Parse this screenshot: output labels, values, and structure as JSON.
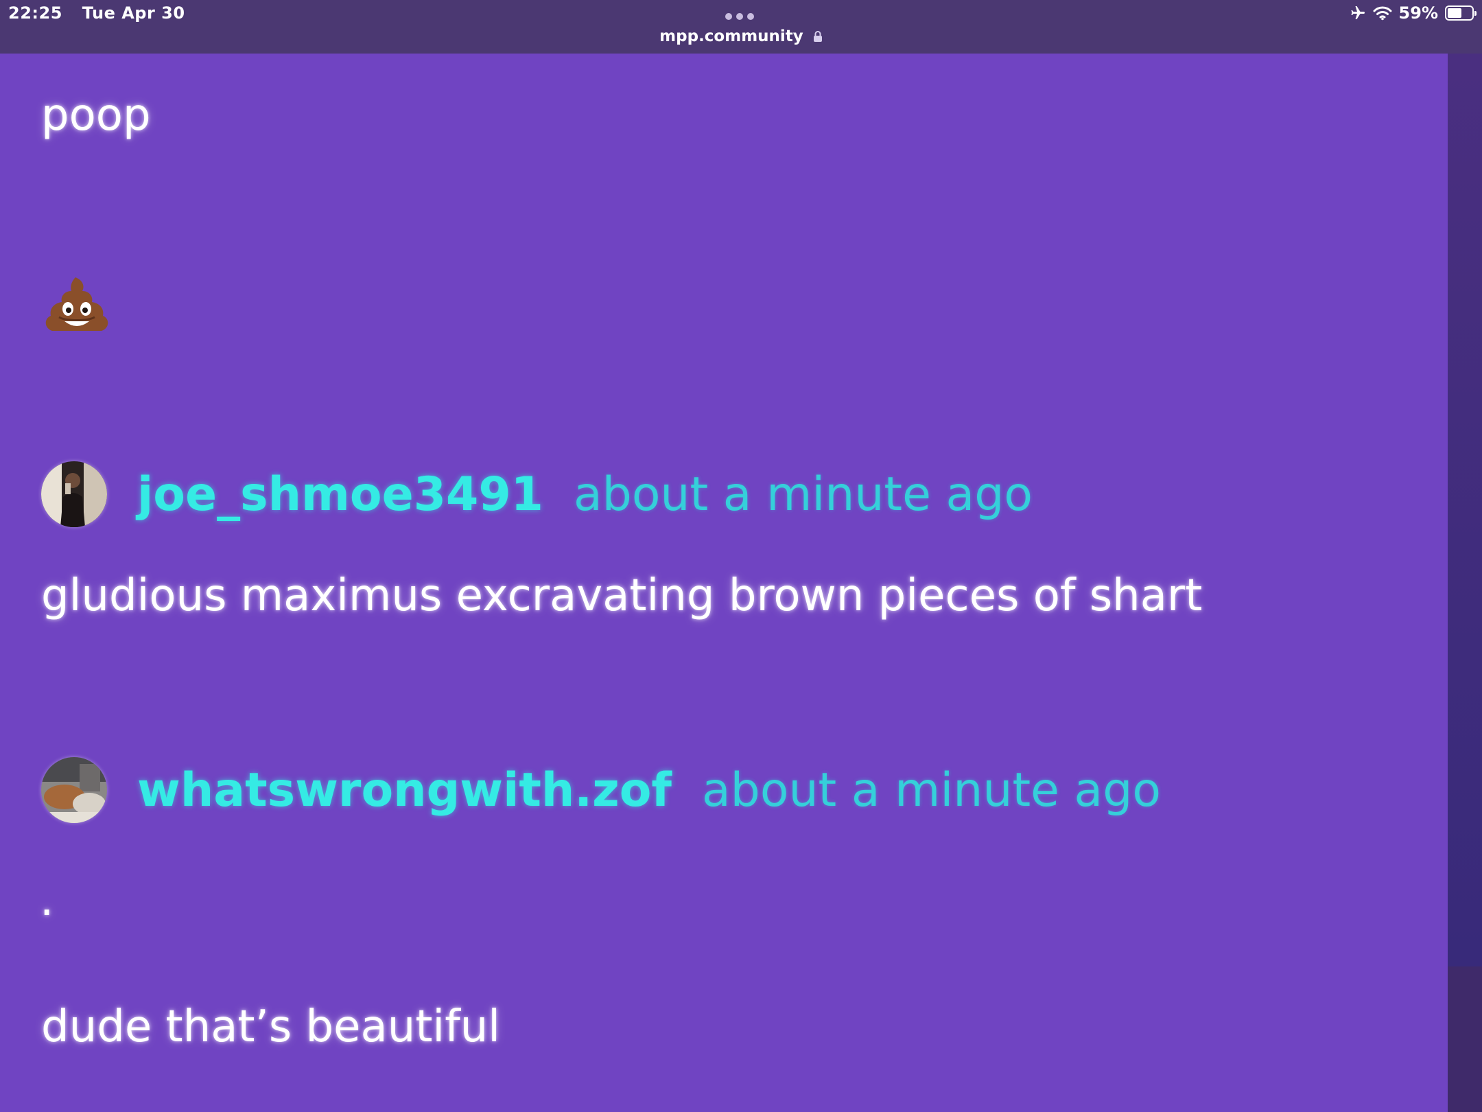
{
  "status_bar": {
    "time": "22:25",
    "date": "Tue Apr 30",
    "battery_percent": "59%",
    "battery_level": 0.59,
    "icons": [
      "airplane-icon",
      "wifi-icon",
      "battery-icon"
    ]
  },
  "browser": {
    "url": "mpp.community",
    "lock_icon": "lock-icon",
    "menu_icon": "more-dots-icon"
  },
  "theme": {
    "background": "#7044c2",
    "status_bar": "#4b3872",
    "username_color": "#35ebe4",
    "timestamp_color": "#35d0da",
    "message_color": "#ffffff"
  },
  "messages": {
    "poop_text": "poop",
    "poop_emoji": "💩"
  },
  "posts": [
    {
      "username": "joe_shmoe3491",
      "timestamp": "about a minute ago",
      "body": "gludious maximus excravating brown pieces of shart"
    },
    {
      "username": "whatswrongwith.zof",
      "timestamp": "about a minute ago",
      "body": ".",
      "reply": "dude that’s beautiful"
    }
  ]
}
